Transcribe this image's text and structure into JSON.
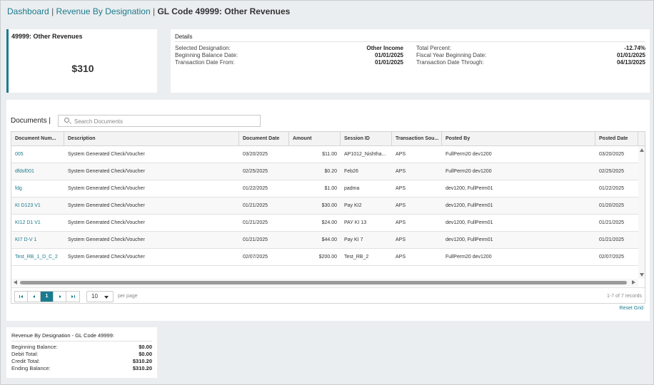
{
  "breadcrumb": {
    "dashboard": "Dashboard",
    "separator": "|",
    "revenue_by_designation": "Revenue By Designation",
    "current": "GL Code 49999: Other Revenues"
  },
  "summary": {
    "title": "49999: Other Revenues",
    "amount": "$310"
  },
  "details": {
    "title": "Details",
    "left": [
      {
        "label": "Selected Designation:",
        "value": "Other Income"
      },
      {
        "label": "Beginning Balance Date:",
        "value": "01/01/2025"
      },
      {
        "label": "Transaction Date From:",
        "value": "01/01/2025"
      }
    ],
    "right": [
      {
        "label": "Total Percent:",
        "value": "-12.74%"
      },
      {
        "label": "Fiscal Year Beginning Date:",
        "value": "01/01/2025"
      },
      {
        "label": "Transaction Date Through:",
        "value": "04/13/2025"
      }
    ]
  },
  "documents": {
    "title": "Documents |",
    "search_placeholder": "Search Documents",
    "columns": [
      "Document Num...",
      "Description",
      "Document Date",
      "Amount",
      "Session ID",
      "Transaction Sou...",
      "Posted By",
      "Posted Date"
    ],
    "rows": [
      {
        "doc": "005",
        "desc": "System Generated Check/Voucher",
        "date": "03/20/2025",
        "amount": "$11.00",
        "session": "AP1012_Nishtha...",
        "source": "APS",
        "posted_by": "FullPerm20 dev1200",
        "posted_date": "03/20/2025"
      },
      {
        "doc": "dfdsf001",
        "desc": "System Generated Check/Voucher",
        "date": "02/25/2025",
        "amount": "$0.20",
        "session": "Feb26",
        "source": "APS",
        "posted_by": "FullPerm20 dev1200",
        "posted_date": "02/25/2025"
      },
      {
        "doc": "fdg",
        "desc": "System Generated Check/Voucher",
        "date": "01/22/2025",
        "amount": "$1.00",
        "session": "padma",
        "source": "APS",
        "posted_by": "dev1200, FullPerm01",
        "posted_date": "01/22/2025"
      },
      {
        "doc": "KI D123 V1",
        "desc": "System Generated Check/Voucher",
        "date": "01/21/2025",
        "amount": "$30.00",
        "session": "Pay KI2",
        "source": "APS",
        "posted_by": "dev1200, FullPerm01",
        "posted_date": "01/20/2025"
      },
      {
        "doc": "KI12 D1 V1",
        "desc": "System Generated Check/Voucher",
        "date": "01/21/2025",
        "amount": "$24.00",
        "session": "PAY KI 13",
        "source": "APS",
        "posted_by": "dev1200, FullPerm01",
        "posted_date": "01/21/2025"
      },
      {
        "doc": "KI7 D-V 1",
        "desc": "System Generated Check/Voucher",
        "date": "01/21/2025",
        "amount": "$44.00",
        "session": "Pay KI 7",
        "source": "APS",
        "posted_by": "dev1200, FullPerm01",
        "posted_date": "01/21/2025"
      },
      {
        "doc": "Test_RB_1_D_C_2",
        "desc": "System Generated Check/Voucher",
        "date": "02/07/2025",
        "amount": "$200.00",
        "session": "Test_RB_2",
        "source": "APS",
        "posted_by": "FullPerm20 dev1200",
        "posted_date": "02/07/2025"
      }
    ],
    "pager": {
      "current_page": "1",
      "page_size": "10",
      "per_page_label": "per page",
      "records": "1-7 of 7 records"
    },
    "reset_label": "Reset Grid"
  },
  "totals": {
    "title": "Revenue By Designation - GL Code 49999:",
    "rows": [
      {
        "label": "Beginning Balance:",
        "value": "$0.00"
      },
      {
        "label": "Debit Total:",
        "value": "$0.00"
      },
      {
        "label": "Credit Total:",
        "value": "$310.20"
      },
      {
        "label": "Ending Balance:",
        "value": "$310.20"
      }
    ]
  },
  "colors": {
    "accent": "#1a7b8f",
    "background": "#ebeef0"
  }
}
